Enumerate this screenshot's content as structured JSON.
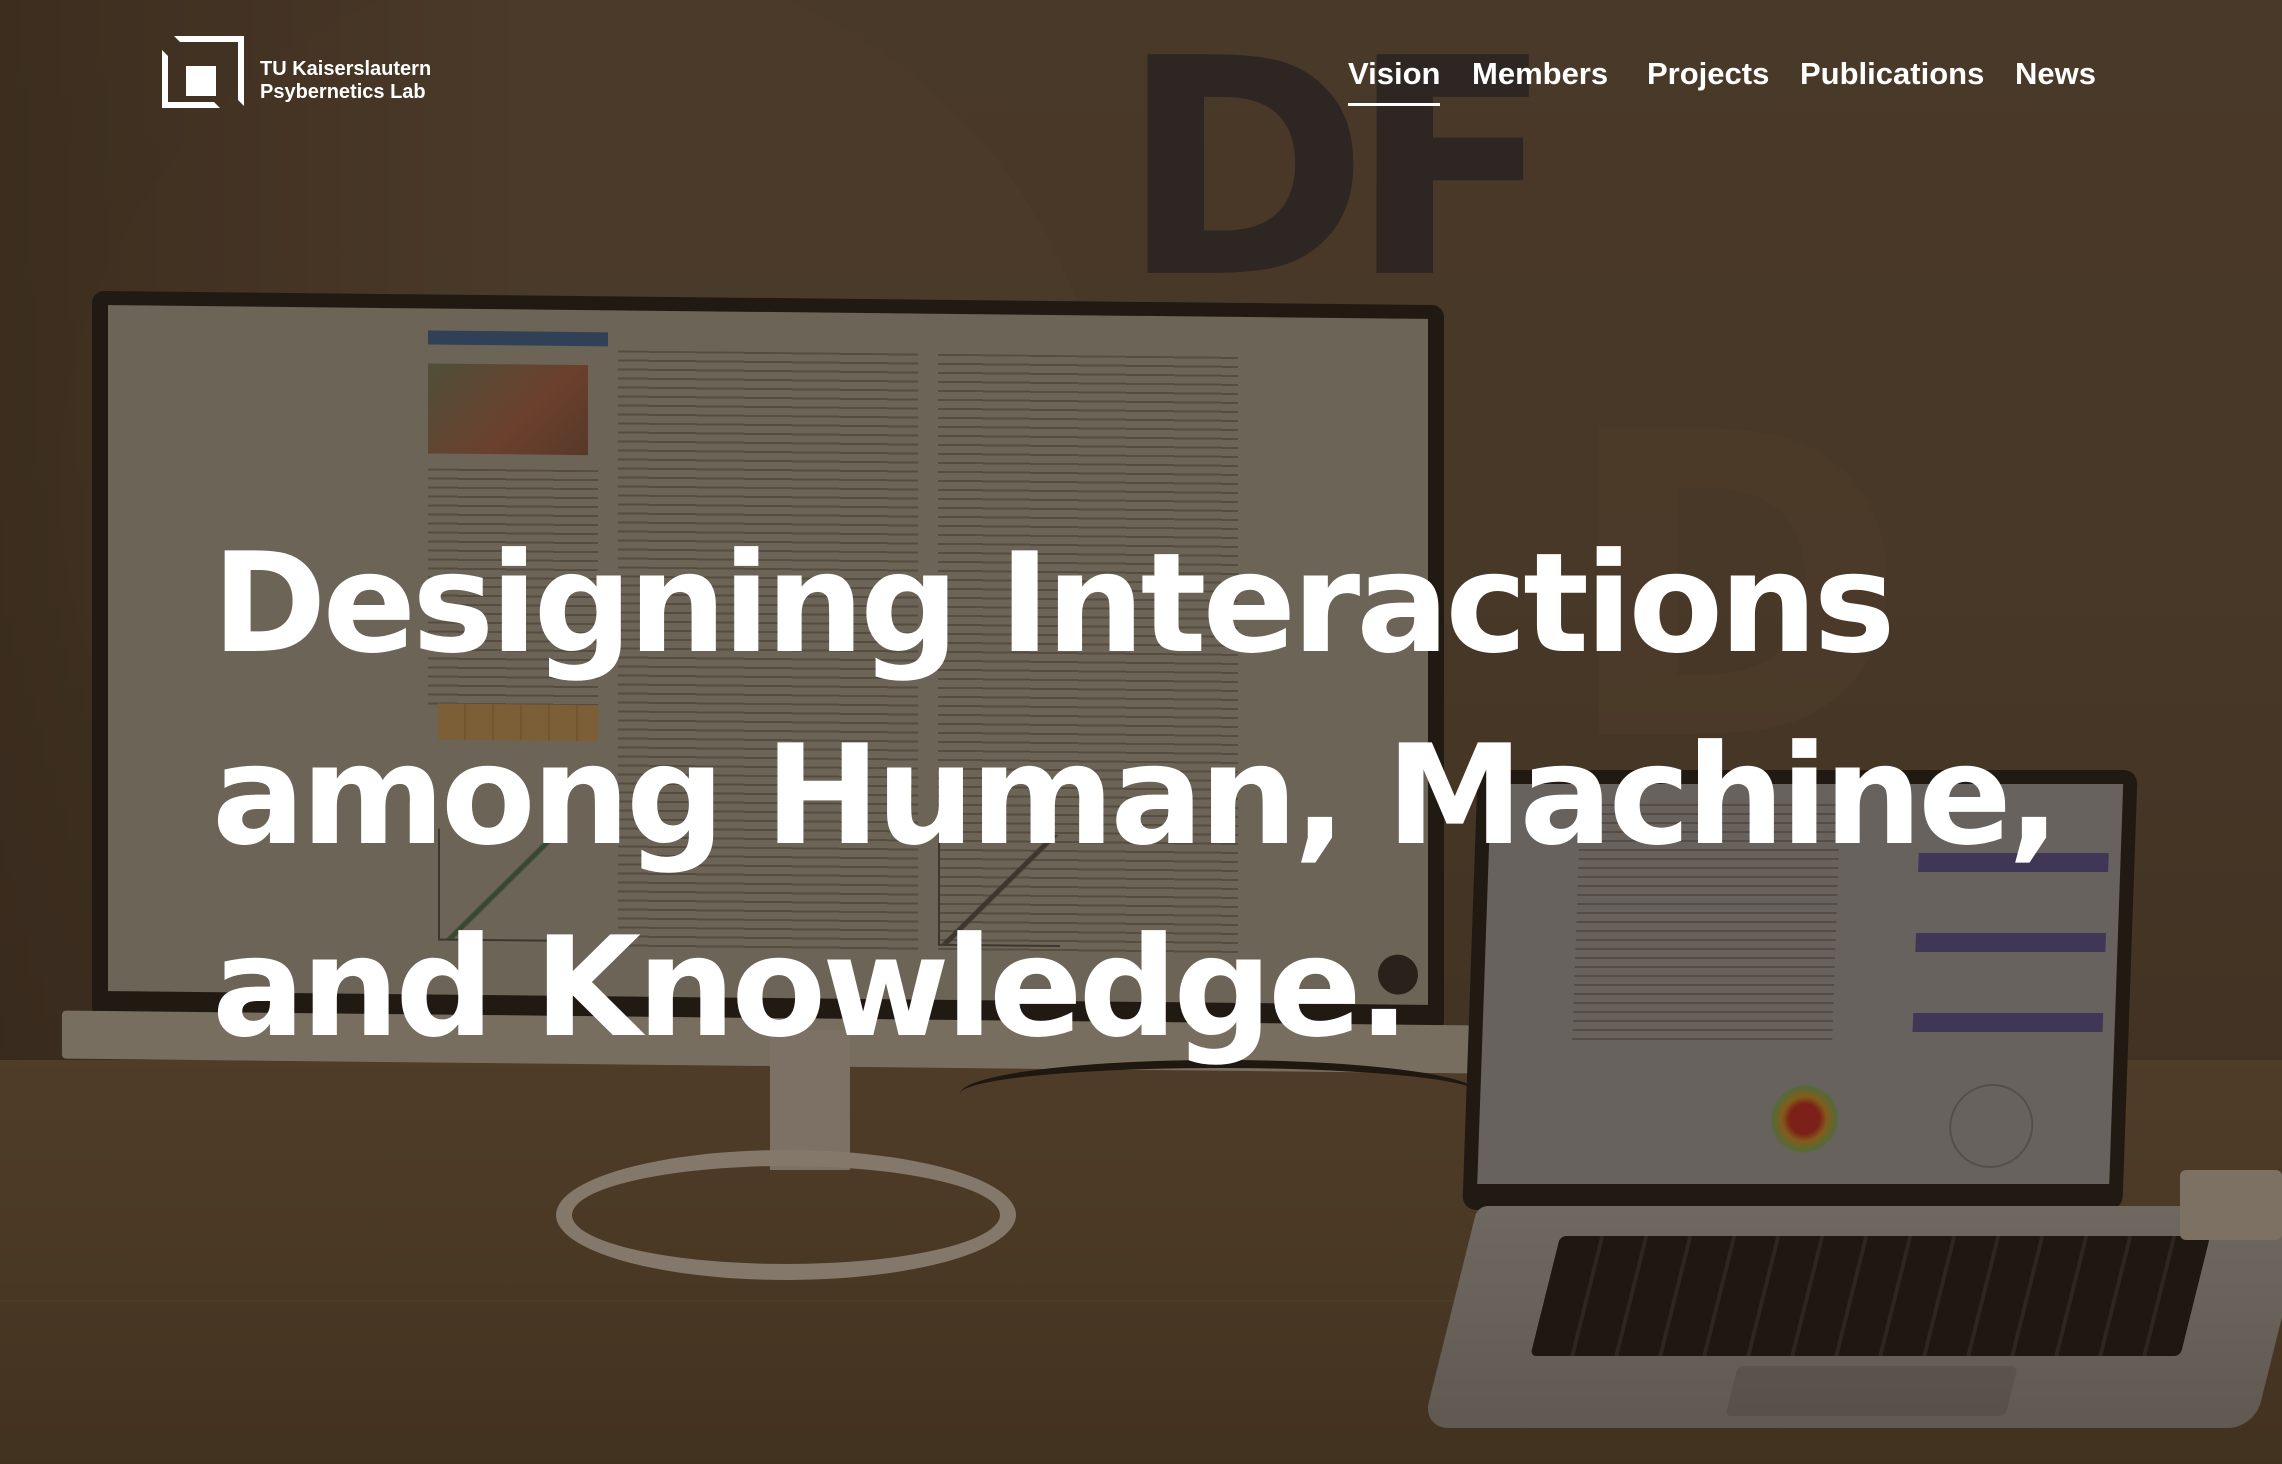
{
  "header": {
    "logo": {
      "icon": "lab-logo-squares",
      "line1": "TU Kaiserslautern",
      "line2": "Psybernetics Lab"
    },
    "nav": [
      {
        "label": "Vision",
        "active": true
      },
      {
        "label": "Members",
        "active": false
      },
      {
        "label": "Projects",
        "active": false
      },
      {
        "label": "Publications",
        "active": false
      },
      {
        "label": "News",
        "active": false
      }
    ]
  },
  "hero": {
    "headline_lines": [
      "Designing Interactions",
      "among Human, Machine,",
      "and Knowledge."
    ]
  },
  "background": {
    "description_icon": "photo-monitor-and-laptop-on-desk",
    "overlay_color": "#281a0c"
  }
}
